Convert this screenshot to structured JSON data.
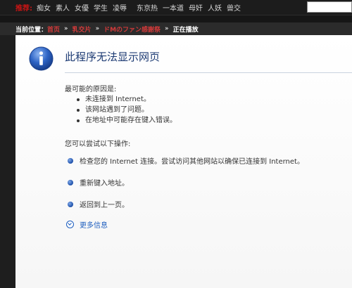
{
  "topnav": {
    "lead": "推荐:",
    "items": [
      "痴女",
      "素人",
      "女優",
      "学生",
      "凌辱",
      "东京热",
      "一本道",
      "母奸",
      "人妖",
      "兽交"
    ]
  },
  "breadcrumb": {
    "label": "当前位置：",
    "links": [
      "首页",
      "乳交片",
      "ドMのファン感謝祭"
    ],
    "separator": "»",
    "current": "正在播放"
  },
  "error": {
    "title": "此程序无法显示网页",
    "reasons_heading": "最可能的原因是:",
    "reasons": [
      "未连接到 Internet。",
      "该网站遇到了问题。",
      "在地址中可能存在键入错误。"
    ],
    "try_heading": "您可以尝试以下操作:",
    "actions": [
      "检查您的 Internet 连接。尝试访问其他网站以确保已连接到 Internet。",
      "重新键入地址。",
      "返回到上一页。"
    ],
    "more_info": "更多信息"
  },
  "colors": {
    "accent_red": "#c81414",
    "link_blue": "#1f5fbf",
    "title_blue": "#1c3a73"
  },
  "icons": {
    "info": "info-icon",
    "bullet": "blue-bullet-icon",
    "expand": "chevron-down-icon"
  }
}
